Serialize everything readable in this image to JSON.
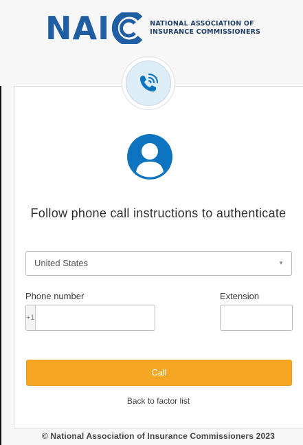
{
  "header": {
    "logo_letters": "NAI",
    "logo_line1": "NATIONAL ASSOCIATION OF",
    "logo_line2": "INSURANCE COMMISSIONERS"
  },
  "factor": {
    "icon": "phone-call-icon",
    "avatar_icon": "user-avatar-icon"
  },
  "main": {
    "title": "Follow phone call instructions to authenticate"
  },
  "form": {
    "country_selected": "United States",
    "phone_label": "Phone number",
    "country_code": "+1",
    "phone_value": "",
    "extension_label": "Extension",
    "extension_value": "",
    "call_label": "Call",
    "back_label": "Back to factor list"
  },
  "footer": {
    "text": "© National Association of Insurance Commissioners 2023"
  },
  "colors": {
    "brand_blue": "#1f5ea3",
    "accent_orange": "#f5a623",
    "avatar_blue": "#0f74bf"
  }
}
